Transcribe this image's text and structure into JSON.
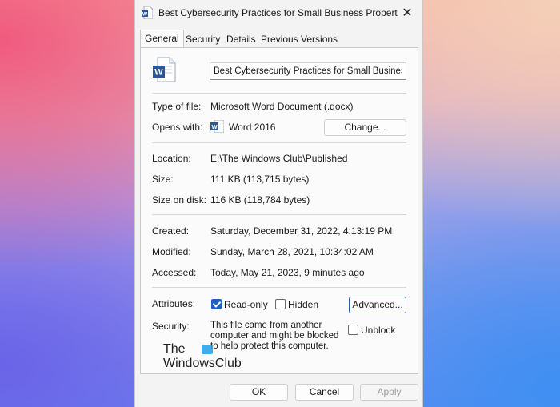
{
  "window": {
    "title": "Best Cybersecurity Practices for Small Business Propert...",
    "close_glyph": "✕"
  },
  "tabs": [
    {
      "label": "General",
      "active": true
    },
    {
      "label": "Security",
      "active": false
    },
    {
      "label": "Details",
      "active": false
    },
    {
      "label": "Previous Versions",
      "active": false
    }
  ],
  "file": {
    "name_value": "Best Cybersecurity Practices for Small Business",
    "icon_name": "word-document-icon"
  },
  "info": {
    "type_label": "Type of file:",
    "type_value": "Microsoft Word Document (.docx)",
    "opens_label": "Opens with:",
    "opens_value": "Word 2016",
    "change_button": "Change...",
    "location_label": "Location:",
    "location_value": "E:\\The Windows Club\\Published",
    "size_label": "Size:",
    "size_value": "111 KB (113,715 bytes)",
    "disk_label": "Size on disk:",
    "disk_value": "116 KB (118,784 bytes)",
    "created_label": "Created:",
    "created_value": "Saturday, December 31, 2022, 4:13:19 PM",
    "modified_label": "Modified:",
    "modified_value": "Sunday, March 28, 2021, 10:34:02 AM",
    "accessed_label": "Accessed:",
    "accessed_value": "Today, May 21, 2023, 9 minutes ago"
  },
  "attributes": {
    "label": "Attributes:",
    "readonly_label": "Read-only",
    "readonly_checked": true,
    "hidden_label": "Hidden",
    "hidden_checked": false,
    "advanced_button": "Advanced..."
  },
  "security": {
    "label": "Security:",
    "text": "This file came from another computer and might be blocked to help protect this computer.",
    "unblock_label": "Unblock",
    "unblock_checked": false
  },
  "watermark": {
    "line1": "The",
    "line2": "WindowsClub"
  },
  "footer": {
    "ok": "OK",
    "cancel": "Cancel",
    "apply": "Apply"
  },
  "colors": {
    "accent": "#1f5fbf",
    "word_blue": "#2b579a"
  }
}
